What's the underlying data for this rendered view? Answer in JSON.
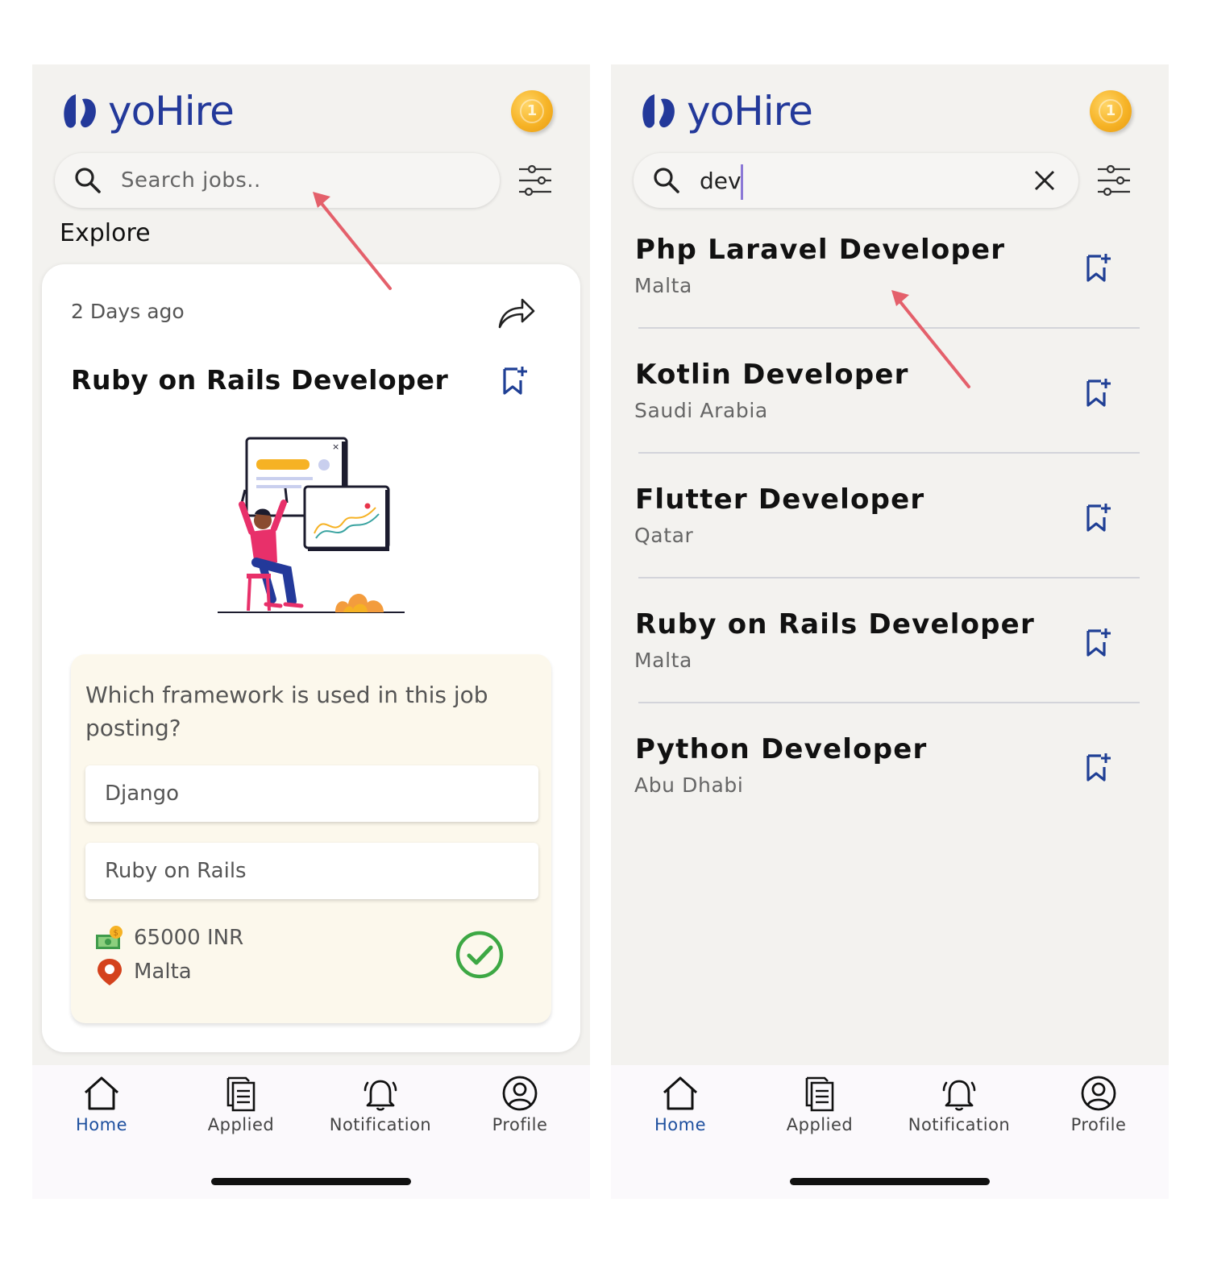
{
  "brand": {
    "name": "yoHire",
    "primary_color": "#23399a",
    "coin_color": "#f6b326",
    "coin_label": "1"
  },
  "left_screen": {
    "search": {
      "placeholder": "Search jobs..",
      "value": ""
    },
    "section_title": "Explore",
    "job_card": {
      "posted": "2 Days ago",
      "title": "Ruby on Rails Developer",
      "quiz": {
        "question": "Which framework is used in this job posting?",
        "options": [
          "Django",
          "Ruby on Rails"
        ]
      },
      "salary": "65000 INR",
      "location": "Malta"
    }
  },
  "right_screen": {
    "search": {
      "value": "dev"
    },
    "results": [
      {
        "title": "Php Laravel Developer",
        "location": "Malta"
      },
      {
        "title": "Kotlin Developer",
        "location": "Saudi Arabia"
      },
      {
        "title": "Flutter Developer",
        "location": "Qatar"
      },
      {
        "title": "Ruby on Rails Developer",
        "location": "Malta"
      },
      {
        "title": "Python Developer",
        "location": "Abu Dhabi"
      }
    ]
  },
  "nav": {
    "active": "Home",
    "active_color": "#1d4f9e",
    "items": [
      "Home",
      "Applied",
      "Notification",
      "Profile"
    ]
  },
  "annotation_color": "#e4606b"
}
